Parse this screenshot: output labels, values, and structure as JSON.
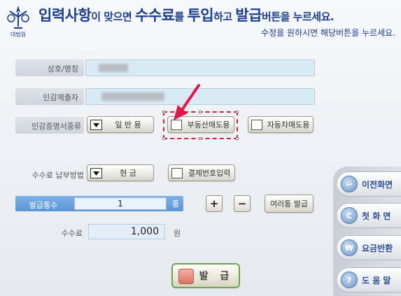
{
  "header": {
    "logo_text": "대법원",
    "title_part1": "입력사항",
    "title_part2": "이 맞으면 ",
    "title_part3": "수수료",
    "title_part4": "를 ",
    "title_part5": "투입",
    "title_part6": "하고 ",
    "title_part7": "발급",
    "title_part8": "버튼을 누르세요.",
    "subtitle": "수정을 원하시면 해당버튼을 누르세요."
  },
  "form": {
    "company_label": "상호/명칭",
    "seal_submitter_label": "인감제출자",
    "cert_type_label": "인감증명서종류",
    "cert_type_value": "일 반 용",
    "real_estate_option": "부동산매도용",
    "vehicle_option": "자동차매도용",
    "payment_label": "수수료 납부방법",
    "payment_value": "현 금",
    "payment_number_option": "결제번호입력",
    "copies_label": "발급통수",
    "copies_value": "1",
    "copies_unit": "통",
    "plus": "+",
    "minus": "−",
    "multi_issue": "여러통 발급",
    "fee_label": "수수료",
    "fee_value": "1,000",
    "fee_unit": "원",
    "issue_button": "발 급"
  },
  "side_nav": {
    "prev": "이전화면",
    "first": "첫 화 면",
    "refund": "요금반환",
    "help": "도 움 말",
    "prev_icon": "↩",
    "first_icon": "C",
    "refund_icon": "₩",
    "help_icon": "?"
  },
  "colors": {
    "title": "#1d3e8c",
    "highlight": "#d6203b",
    "arrow": "#e2174a",
    "field": "#d9eaf5",
    "issue_border": "#6ca44e"
  }
}
